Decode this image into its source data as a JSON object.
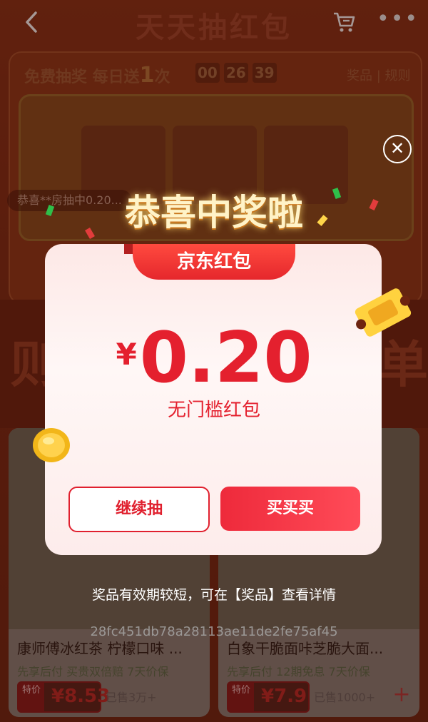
{
  "header": {
    "title": "天天抽红包"
  },
  "lottery": {
    "prefix": "免费抽奖 每日送",
    "count": "1",
    "suffix": "次",
    "timer": [
      "00",
      "26",
      "39"
    ],
    "links": "奖品 | 规则"
  },
  "ticker": {
    "text": "恭喜**房抽中0.20..."
  },
  "banner": {
    "left": "则",
    "right": "单"
  },
  "products": [
    {
      "title": "康师傅冰红茶 柠檬口味 ...",
      "tags": "先享后付  买贵双倍赔  7天价保",
      "badge": "特价",
      "price": "¥8.53",
      "sold": "已售3万+"
    },
    {
      "title": "白象干脆面咔芝脆大面...",
      "tags": "先享后付  12期免息  7天价保",
      "badge": "特价",
      "price": "¥7.9",
      "sold": "已售1000+"
    }
  ],
  "modal": {
    "headline": "恭喜中奖啦",
    "tag": "京东红包",
    "currency": "¥",
    "amount": "0.20",
    "subtitle": "无门槛红包",
    "continue_label": "继续抽",
    "buy_label": "买买买",
    "note": "奖品有效期较短，可在【奖品】查看详情",
    "close": "✕"
  },
  "watermark": "28fc451db78a28113ae11de2fe75af45",
  "colors": {
    "accent": "#e4202e"
  }
}
